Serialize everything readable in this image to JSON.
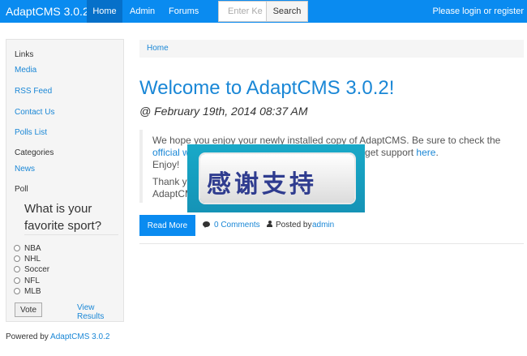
{
  "navbar": {
    "brand": "AdaptCMS 3.0.2",
    "items": [
      {
        "label": "Home"
      },
      {
        "label": "Admin"
      },
      {
        "label": "Forums"
      }
    ],
    "search": {
      "placeholder": "Enter Ke",
      "button": "Search"
    },
    "login": "Please login or register"
  },
  "sidebar": {
    "links_heading": "Links",
    "links": [
      {
        "label": "Media"
      },
      {
        "label": "RSS Feed"
      },
      {
        "label": "Contact Us"
      },
      {
        "label": "Polls List"
      }
    ],
    "categories_heading": "Categories",
    "categories": [
      {
        "label": "News"
      }
    ],
    "poll_heading": "Poll",
    "poll": {
      "question": "What is your favorite sport?",
      "options": [
        "NBA",
        "NHL",
        "Soccer",
        "NFL",
        "MLB"
      ],
      "vote_label": "Vote",
      "results_label": "View Results"
    }
  },
  "breadcrumb": {
    "home": "Home"
  },
  "article": {
    "title": "Welcome to AdaptCMS 3.0.2!",
    "date": "@ February 19th, 2014 08:37 AM",
    "body": {
      "line1": "We hope you enjoy your newly installed copy of AdaptCMS. Be sure to check the",
      "line2_link": "official w",
      "line2_mid": "nd you can get support ",
      "line2_link2": "here",
      "line2_end": ".",
      "line3": "Enjoy!",
      "line4": "Thank y",
      "line5": "AdaptCM"
    },
    "overlay_text": "感谢支持",
    "read_more": "Read More",
    "comments": "0 Comments",
    "posted_by": "Posted by ",
    "author": "admin"
  },
  "footer": {
    "prefix": "Powered by ",
    "link": "AdaptCMS 3.0.2"
  },
  "colors": {
    "accent": "#0a8bf0",
    "link": "#1a87d6",
    "overlay": "#1593b6"
  }
}
